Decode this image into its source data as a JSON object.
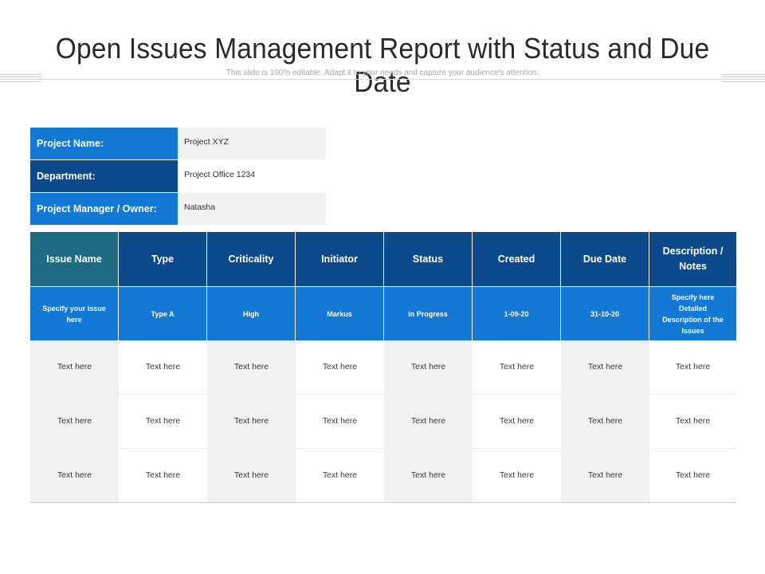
{
  "header": {
    "title": "Open Issues Management Report with Status and Due Date",
    "subtitle": "This slide is 100% editable. Adapt it to your needs and capture your audience's attention."
  },
  "project_info": [
    {
      "label": "Project Name:",
      "value": "Project XYZ"
    },
    {
      "label": "Department:",
      "value": "Project Office  1234"
    },
    {
      "label": "Project Manager / Owner:",
      "value": "Natasha"
    }
  ],
  "issues_table": {
    "columns": [
      "Issue Name",
      "Type",
      "Criticality",
      "Initiator",
      "Status",
      "Created",
      "Due Date",
      "Description / Notes"
    ],
    "spec_row": [
      "Specify your issue here",
      "Type A",
      "High",
      "Markus",
      "In Progress",
      "1-09-20",
      "31-10-20",
      "Specify here Detailed Description of the Issues"
    ],
    "rows": [
      [
        "Text here",
        "Text here",
        "Text here",
        "Text here",
        "Text here",
        "Text here",
        "Text here",
        "Text here"
      ],
      [
        "Text here",
        "Text here",
        "Text here",
        "Text here",
        "Text here",
        "Text here",
        "Text here",
        "Text here"
      ],
      [
        "Text here",
        "Text here",
        "Text here",
        "Text here",
        "Text here",
        "Text here",
        "Text here",
        "Text here"
      ]
    ]
  }
}
